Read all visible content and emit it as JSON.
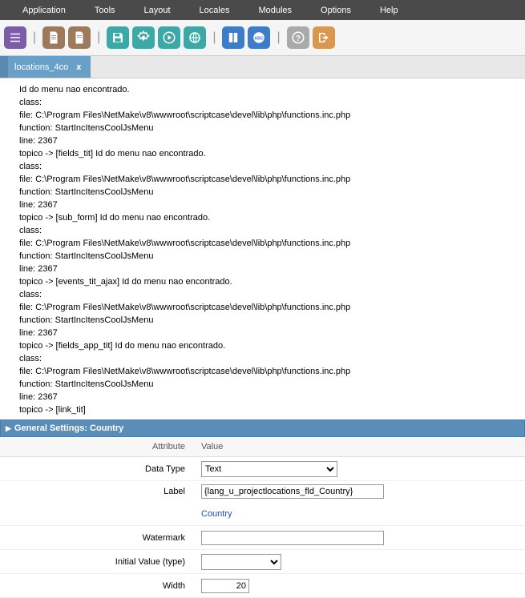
{
  "menu": [
    "Application",
    "Tools",
    "Layout",
    "Locales",
    "Modules",
    "Options",
    "Help"
  ],
  "tab": {
    "label": "locations_4co",
    "close": "x"
  },
  "log": [
    "Id do menu nao encontrado.",
    "class:",
    "file: C:\\Program Files\\NetMake\\v8\\wwwroot\\scriptcase\\devel\\lib\\php\\functions.inc.php",
    "function: StartIncItensCoolJsMenu",
    "line: 2367",
    "topico -> [fields_tit] Id do menu nao encontrado.",
    "class:",
    "file: C:\\Program Files\\NetMake\\v8\\wwwroot\\scriptcase\\devel\\lib\\php\\functions.inc.php",
    "function: StartIncItensCoolJsMenu",
    "line: 2367",
    "topico -> [sub_form] Id do menu nao encontrado.",
    "class:",
    "file: C:\\Program Files\\NetMake\\v8\\wwwroot\\scriptcase\\devel\\lib\\php\\functions.inc.php",
    "function: StartIncItensCoolJsMenu",
    "line: 2367",
    "topico -> [events_tit_ajax] Id do menu nao encontrado.",
    "class:",
    "file: C:\\Program Files\\NetMake\\v8\\wwwroot\\scriptcase\\devel\\lib\\php\\functions.inc.php",
    "function: StartIncItensCoolJsMenu",
    "line: 2367",
    "topico -> [fields_app_tit] Id do menu nao encontrado.",
    "class:",
    "file: C:\\Program Files\\NetMake\\v8\\wwwroot\\scriptcase\\devel\\lib\\php\\functions.inc.php",
    "function: StartIncItensCoolJsMenu",
    "line: 2367",
    "topico -> [link_tit]"
  ],
  "panel": {
    "title": "General Settings: Country"
  },
  "headers": {
    "attr": "Attribute",
    "val": "Value"
  },
  "form": {
    "dataType": {
      "label": "Data Type",
      "value": "Text"
    },
    "label": {
      "label": "Label",
      "value": "{lang_u_projectlocations_fld_Country}",
      "resolved": "Country"
    },
    "watermark": {
      "label": "Watermark",
      "value": ""
    },
    "initial": {
      "label": "Initial Value (type)",
      "value": ""
    },
    "width": {
      "label": "Width",
      "value": "20"
    }
  }
}
